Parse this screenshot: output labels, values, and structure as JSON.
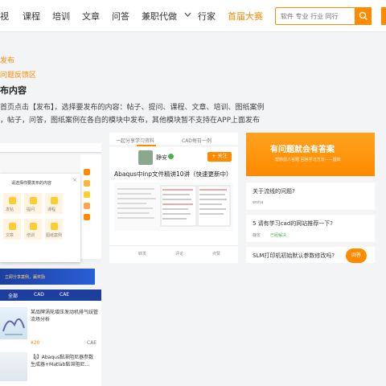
{
  "nav": {
    "items": [
      "视",
      "课程",
      "培训",
      "文章",
      "问答",
      "兼职代做",
      "行家",
      "首届大赛"
    ],
    "search_placeholder": "软件 专业 行业 同行"
  },
  "breadcrumb": "发布",
  "section_tag": "问题反馈区",
  "heading": "布内容",
  "desc_line1": "首页点击【发布】，选择要发布的内容：帖子、提问、课程、文章、培训、图纸案例",
  "desc_line2": "，帖子，问答，图纸案例在各自的模块中发布，其他模块暂不支持在APP上面发布",
  "shot1": {
    "dialog_title": "请选择你要发布的内容",
    "items": [
      "发帖",
      "提问",
      "课程",
      "文章",
      "培训",
      "图纸案例"
    ],
    "tabs": [
      "全部",
      "CAD",
      "CAE"
    ],
    "banner_text": "立即分享案例，赢奖励",
    "product1_title": "某品牌涡轮增压发动机排气歧管流场分析",
    "product1_price": "¥20",
    "product1_tag": "CAE",
    "product2_title": "【J】Abaqus黏滞阻尼器参数生成器+Matlab黏滞阻尼...",
    "product2_tag": "CAE"
  },
  "shot2": {
    "tab1": "一起分享学习资料",
    "tab2": "CAD每日一例",
    "user": "静安",
    "follow": "+ 关注",
    "post_title": "Abaqus中inp文件精讲10讲（快速更新中）",
    "actions": [
      "转发",
      "评论",
      "点赞"
    ]
  },
  "shot3": {
    "banner_title": "有问题就会有答案",
    "banner_sub": "帮你找人答题 回答学习方法——题库",
    "q1": "关于流线的问题?",
    "q2": "5 请有学习cad的网站推荐一下?",
    "q3": "SLM打印机初始默认参数修改吗?",
    "answer_btn": "回答",
    "q1_user": "woha",
    "q2_user": "静安",
    "q2_tag": "已经解决"
  },
  "colors": {
    "accent": "#ff8a00"
  }
}
